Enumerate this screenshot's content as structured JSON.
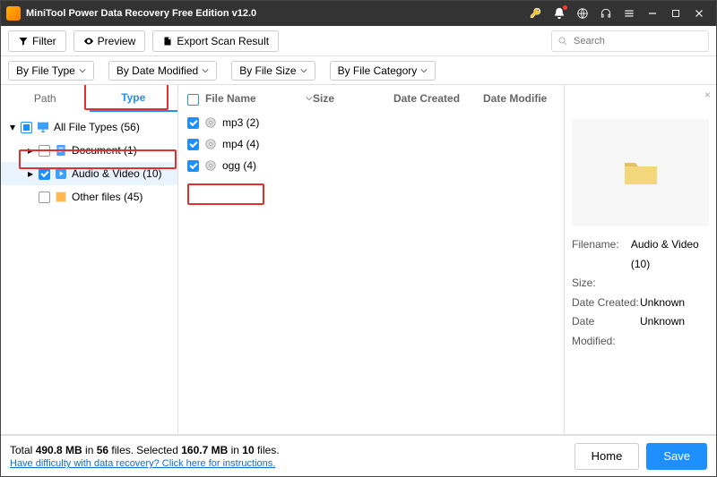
{
  "window": {
    "title": "MiniTool Power Data Recovery Free Edition v12.0"
  },
  "toolbar": {
    "filter": "Filter",
    "preview": "Preview",
    "export": "Export Scan Result",
    "search_placeholder": "Search"
  },
  "filters": {
    "by_type": "By File Type",
    "by_date": "By Date Modified",
    "by_size": "By File Size",
    "by_cat": "By File Category"
  },
  "sidebar": {
    "tabs": {
      "path": "Path",
      "type": "Type"
    },
    "tree": {
      "root": {
        "label": "All File Types (56)",
        "checked": "mixed"
      },
      "children": [
        {
          "label": "Document (1)",
          "checked": false,
          "icon": "doc"
        },
        {
          "label": "Audio & Video (10)",
          "checked": true,
          "icon": "av",
          "selected": true
        },
        {
          "label": "Other files (45)",
          "checked": false,
          "icon": "other"
        }
      ]
    }
  },
  "filelist": {
    "columns": {
      "name": "File Name",
      "size": "Size",
      "date_created": "Date Created",
      "date_modified": "Date Modifie"
    },
    "rows": [
      {
        "name": "mp3 (2)",
        "checked": true
      },
      {
        "name": "mp4 (4)",
        "checked": true
      },
      {
        "name": "ogg (4)",
        "checked": true
      }
    ]
  },
  "preview": {
    "meta": {
      "filename_label": "Filename:",
      "filename": "Audio & Video (10)",
      "size_label": "Size:",
      "size": "",
      "dc_label": "Date Created:",
      "dc": "Unknown",
      "dm_label": "Date Modified:",
      "dm": "Unknown"
    }
  },
  "footer": {
    "total_prefix": "Total ",
    "total_size": "490.8 MB",
    "total_mid": " in ",
    "total_files": "56",
    "total_suffix": " files.",
    "sel_prefix": "   Selected ",
    "sel_size": "160.7 MB",
    "sel_mid": " in ",
    "sel_files": "10",
    "sel_suffix": " files.",
    "help": "Have difficulty with data recovery? Click here for instructions.",
    "home": "Home",
    "save": "Save"
  }
}
